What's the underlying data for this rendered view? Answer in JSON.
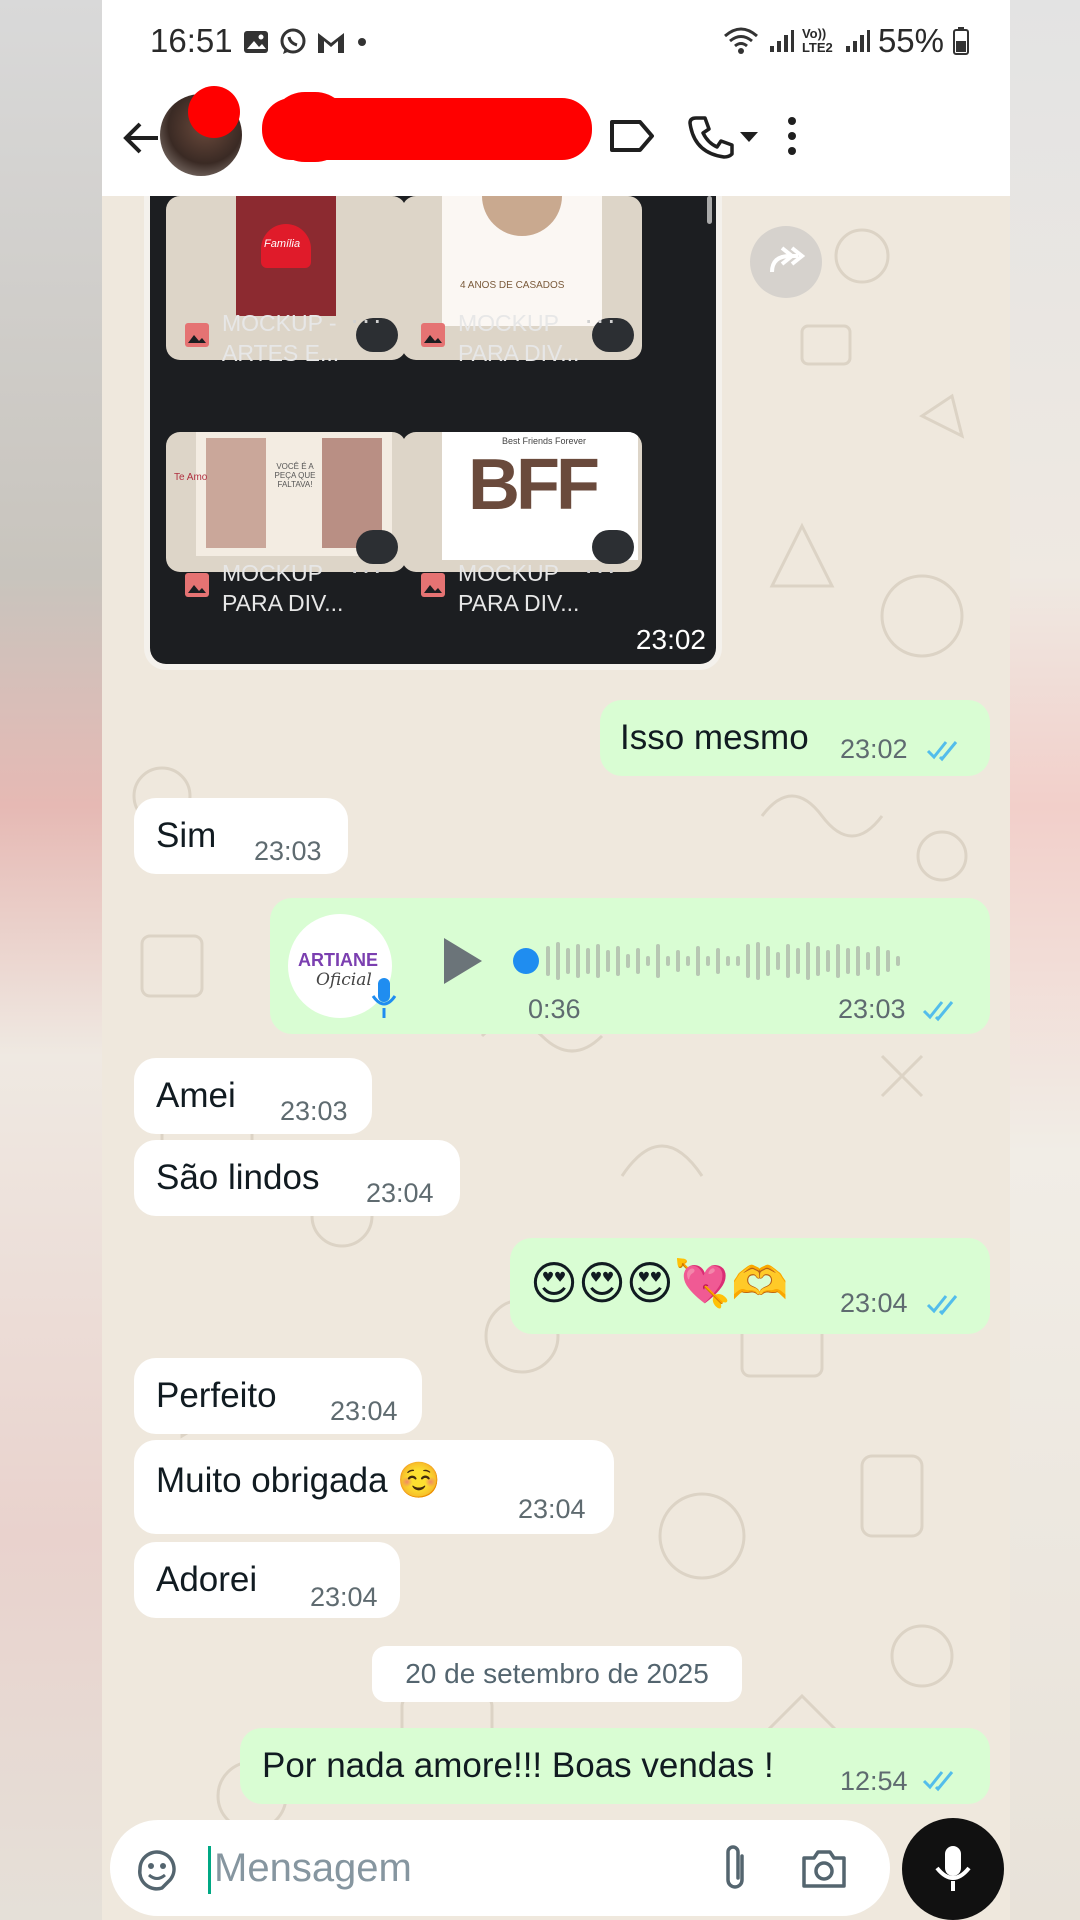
{
  "status_bar": {
    "time": "16:51",
    "left_icons": [
      "gallery-icon",
      "whatsapp-icon",
      "gmail-icon",
      "dot-icon"
    ],
    "right_icons": [
      "wifi-icon",
      "signal-icon",
      "volte-icon",
      "signal-icon"
    ],
    "volte_label": "Vo)) LTE2",
    "battery": "55%"
  },
  "header": {
    "contact_name": "",
    "icons": [
      "back-arrow-icon",
      "label-icon",
      "phone-icon",
      "dropdown-icon",
      "more-vertical-icon"
    ]
  },
  "media_message": {
    "time": "23:02",
    "items": [
      {
        "label_line1": "MOCKUP -",
        "label_line2": "ARTES E...",
        "tile_text": "Família"
      },
      {
        "label_line1": "MOCKUP",
        "label_line2": "PARA DIV...",
        "tile_text": "4 ANOS DE CASADOS"
      },
      {
        "label_line1": "MOCKUP",
        "label_line2": "PARA DIV...",
        "tile_text": "VOCÊ É A PEÇA QUE FALTAVA!"
      },
      {
        "label_line1": "MOCKUP",
        "label_line2": "PARA DIV...",
        "tile_text": "BFF"
      }
    ],
    "tile_subtext": [
      "",
      "",
      "Te Amo",
      "Best Friends Forever"
    ]
  },
  "messages": [
    {
      "dir": "out",
      "text": "Isso mesmo",
      "time": "23:02",
      "read": true
    },
    {
      "dir": "in",
      "text": "Sim",
      "time": "23:03"
    },
    {
      "dir": "out",
      "type": "audio",
      "duration": "0:36",
      "time": "23:03",
      "read": true,
      "avatar_text_1": "ARTIANE",
      "avatar_text_2": "Oficial"
    },
    {
      "dir": "in",
      "text": "Amei",
      "time": "23:03"
    },
    {
      "dir": "in",
      "text": "São lindos",
      "time": "23:04"
    },
    {
      "dir": "out",
      "text": "😍😍😍💘🫶",
      "time": "23:04",
      "read": true
    },
    {
      "dir": "in",
      "text": "Perfeito",
      "time": "23:04"
    },
    {
      "dir": "in",
      "text": "Muito obrigada ☺️",
      "time": "23:04"
    },
    {
      "dir": "in",
      "text": "Adorei",
      "time": "23:04"
    },
    {
      "dir": "out",
      "text": "Por nada amore!!! Boas vendas !",
      "time": "12:54",
      "read": true
    }
  ],
  "date_separator": "20 de setembro de 2025",
  "input": {
    "placeholder": "Mensagem",
    "icons": [
      "sticker-icon",
      "attach-icon",
      "camera-icon",
      "mic-icon"
    ]
  },
  "colors": {
    "wallpaper": "#efe8dd",
    "incoming_bubble": "#ffffff",
    "outgoing_bubble": "#d9fdd3",
    "read_ticks": "#53bdeb",
    "redaction": "#ff0000"
  }
}
